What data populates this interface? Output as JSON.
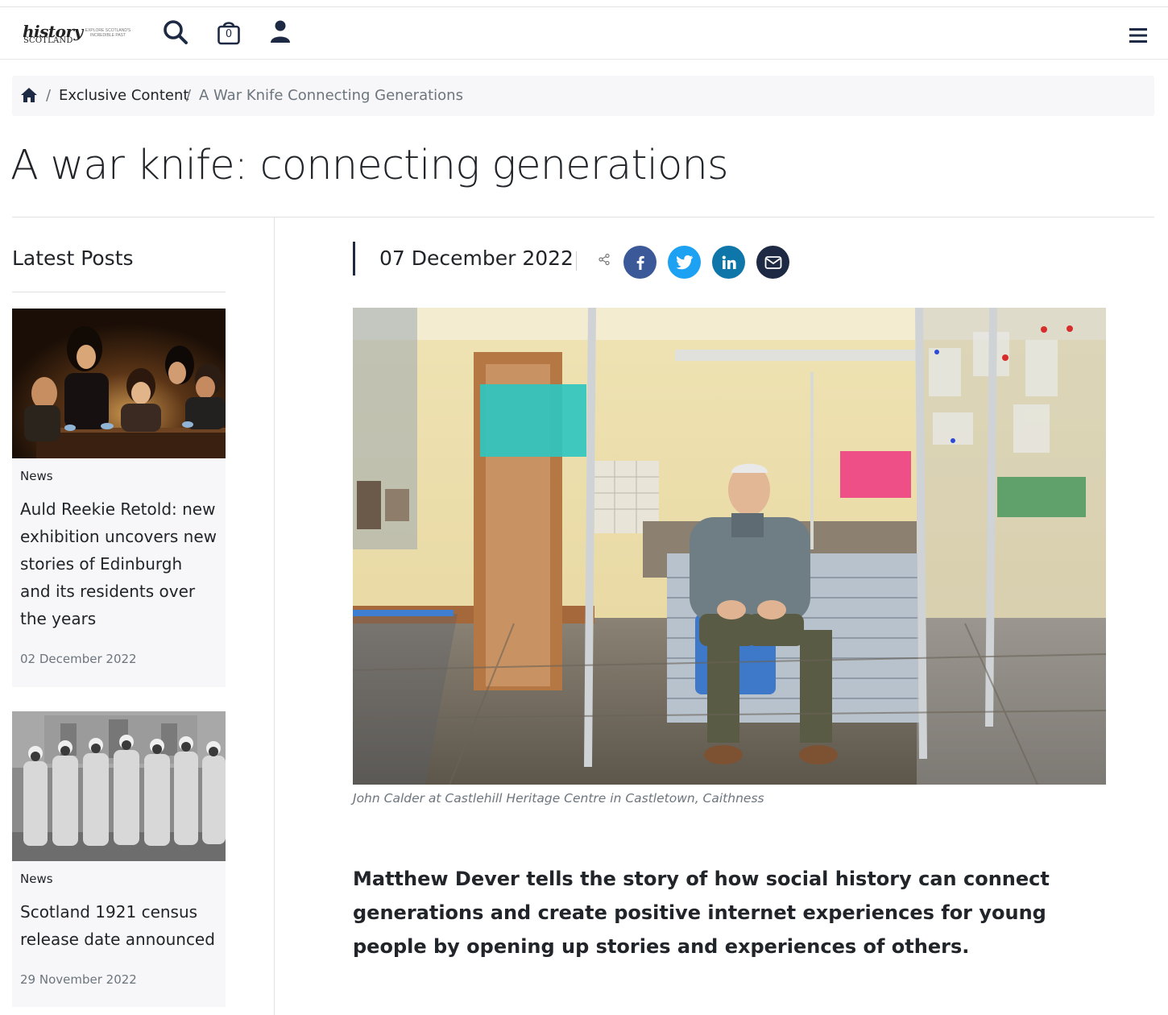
{
  "header": {
    "logo_main": "history",
    "logo_sub": "SCOTLAND",
    "logo_tagline": "EXPLORE SCOTLAND'S INCREDIBLE PAST",
    "cart_count": "0",
    "icons": [
      "search-icon",
      "cart-bag-icon",
      "user-icon",
      "hamburger-menu-icon"
    ]
  },
  "breadcrumb": {
    "sep": "/",
    "link": "Exclusive Content",
    "current": "A War Knife Connecting Generations"
  },
  "page": {
    "title": "A war knife: connecting generations"
  },
  "sidebar": {
    "title": "Latest Posts",
    "posts": [
      {
        "category": "News",
        "title": "Auld Reekie Retold: new exhibition uncovers new stories of Edinburgh and its residents over the years",
        "date": "02 December 2022"
      },
      {
        "category": "News",
        "title": "Scotland 1921 census release date announced",
        "date": "29 November 2022"
      }
    ]
  },
  "article": {
    "date": "07 December 2022",
    "share_icons": [
      "facebook-icon",
      "twitter-icon",
      "linkedin-icon",
      "email-icon"
    ],
    "colors": {
      "facebook": "#3b5998",
      "twitter": "#1da1f2",
      "linkedin": "#0e76a8",
      "email": "#1e2a44"
    },
    "caption": "John Calder at Castlehill Heritage Centre in Castletown, Caithness",
    "lede": "Matthew Dever tells the story of how social history can connect generations and create positive internet experiences for young people by opening up stories and experiences of others."
  }
}
